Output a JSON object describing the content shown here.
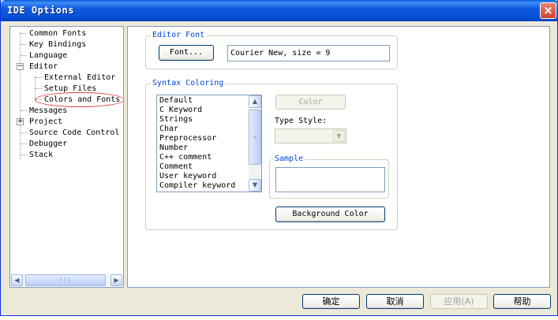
{
  "window": {
    "title": "IDE Options",
    "close_label": "×"
  },
  "tree": {
    "items": [
      {
        "label": "Common Fonts"
      },
      {
        "label": "Key Bindings"
      },
      {
        "label": "Language"
      },
      {
        "label": "Editor",
        "expander": "⊟"
      },
      {
        "label": "External Editor"
      },
      {
        "label": "Setup Files"
      },
      {
        "label": "Colors and Fonts",
        "selected": true
      },
      {
        "label": "Messages"
      },
      {
        "label": "Project",
        "expander": "⊞"
      },
      {
        "label": "Source Code Control"
      },
      {
        "label": "Debugger"
      },
      {
        "label": "Stack"
      }
    ],
    "scroll_left": "◀",
    "scroll_right": "▶",
    "scroll_grip": "|||"
  },
  "editor_font": {
    "legend": "Editor Font",
    "font_button": "Font...",
    "font_value": "Courier New, size = 9"
  },
  "syntax": {
    "legend": "Syntax Coloring",
    "items": [
      "Default",
      "C Keyword",
      "Strings",
      "Char",
      "Preprocessor",
      "Number",
      "C++ comment",
      "Comment",
      "User keyword",
      "Compiler keyword"
    ],
    "scroll_up": "▲",
    "scroll_down": "▼",
    "scroll_grip": "≡",
    "color_button": "Color",
    "type_style_label": "Type Style:",
    "combo_arrow": "▼",
    "sample_legend": "Sample",
    "background_button": "Background Color"
  },
  "footer": {
    "ok": "确定",
    "cancel": "取消",
    "apply": "应用(A)",
    "help": "帮助"
  }
}
